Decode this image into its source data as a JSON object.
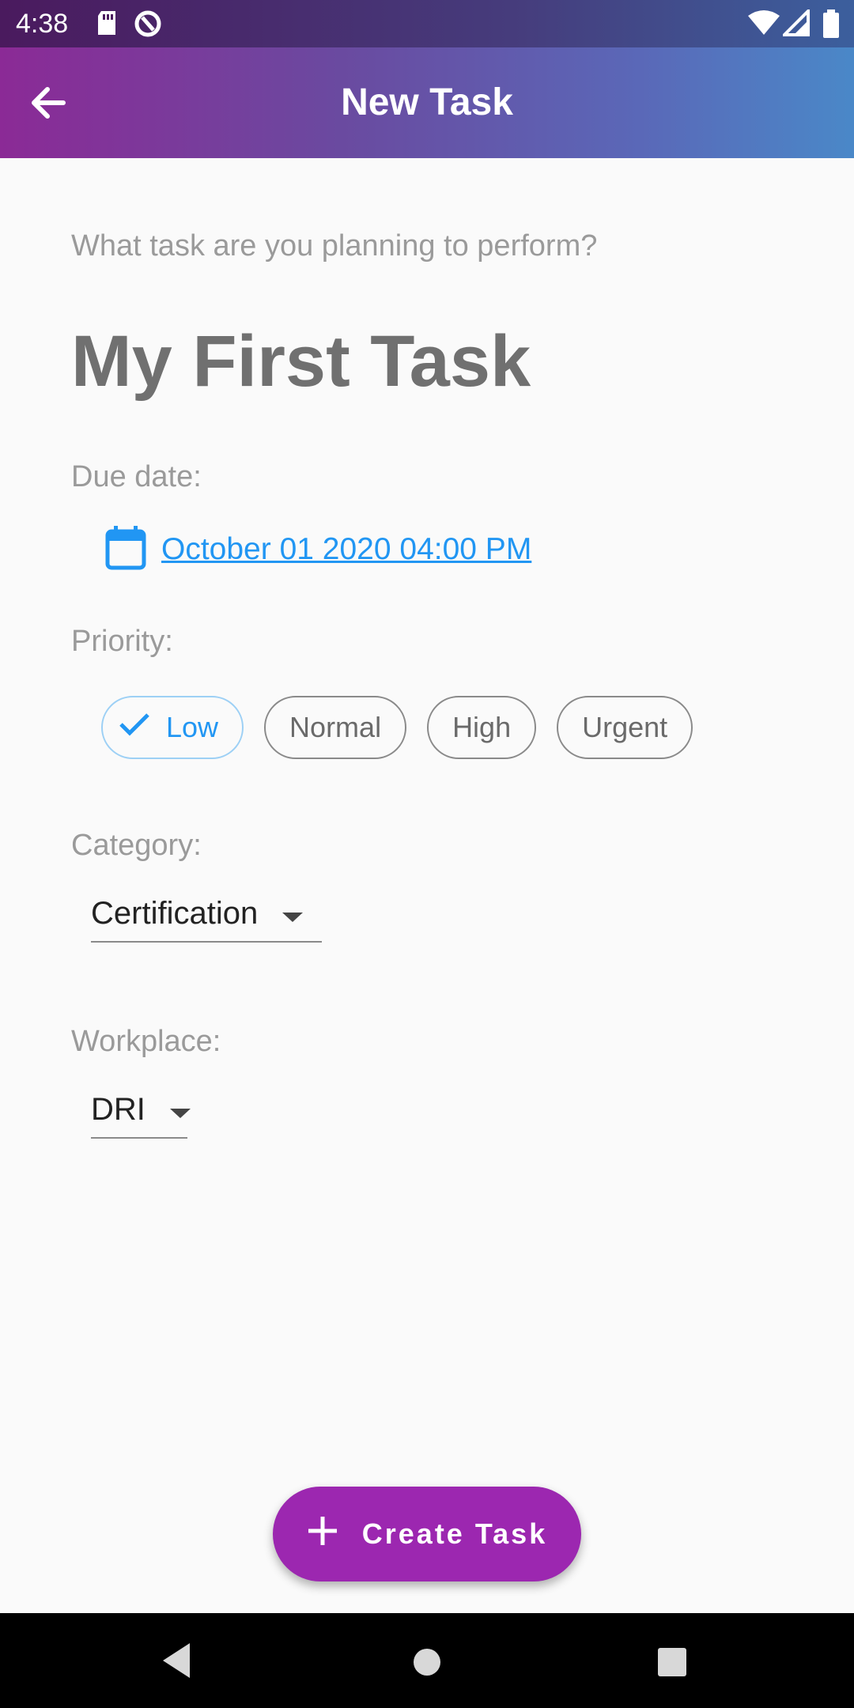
{
  "status_bar": {
    "time": "4:38",
    "icons": [
      "sd-card-icon",
      "sync-icon",
      "wifi-icon",
      "signal-icon",
      "battery-icon"
    ]
  },
  "app_bar": {
    "title": "New Task",
    "back_icon": "arrow-back-icon"
  },
  "form": {
    "prompt": "What task are you planning to perform?",
    "task_name": "My First Task",
    "due_label": "Due date:",
    "due_value": "October 01 2020 04:00 PM",
    "priority_label": "Priority:",
    "priorities": [
      "Low",
      "Normal",
      "High",
      "Urgent"
    ],
    "priority_selected": "Low",
    "category_label": "Category:",
    "category_value": "Certification",
    "workplace_label": "Workplace:",
    "workplace_value": "DRI"
  },
  "fab": {
    "label": "Create Task",
    "icon": "plus-icon"
  },
  "nav": {
    "icons": [
      "back-triangle-icon",
      "home-circle-icon",
      "recents-square-icon"
    ]
  },
  "colors": {
    "accent": "#2196f3",
    "fab": "#9c27b0",
    "appbar_start": "#8b2a96",
    "appbar_end": "#4a88c8"
  }
}
